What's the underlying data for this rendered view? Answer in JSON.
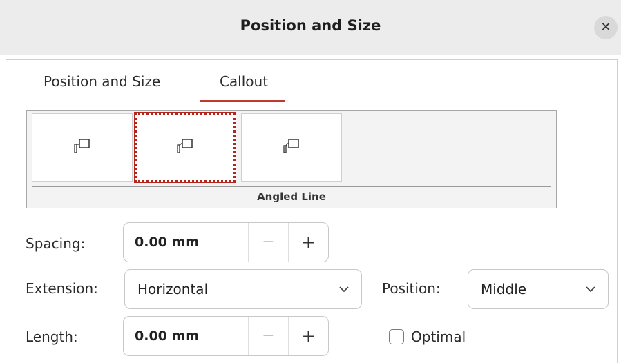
{
  "window": {
    "title": "Position and Size",
    "close_icon": "close-icon"
  },
  "tabs": [
    {
      "label": "Position and Size",
      "active": false
    },
    {
      "label": "Callout",
      "active": true
    }
  ],
  "callout_styles": {
    "items": [
      "callout-style-icon",
      "callout-style-icon",
      "callout-style-icon"
    ],
    "selected_index": 1,
    "selected_label": "Angled Line"
  },
  "spacing": {
    "label": "Spacing:",
    "value": "0.00 mm",
    "minus": "−",
    "plus": "+"
  },
  "extension": {
    "label": "Extension:",
    "value": "Horizontal"
  },
  "position": {
    "label": "Position:",
    "value": "Middle"
  },
  "length": {
    "label": "Length:",
    "value": "0.00 mm",
    "minus": "−",
    "plus": "+"
  },
  "optimal": {
    "label": "Optimal",
    "checked": false
  },
  "colors": {
    "accent": "#c0392b",
    "selection": "#b3261e"
  }
}
